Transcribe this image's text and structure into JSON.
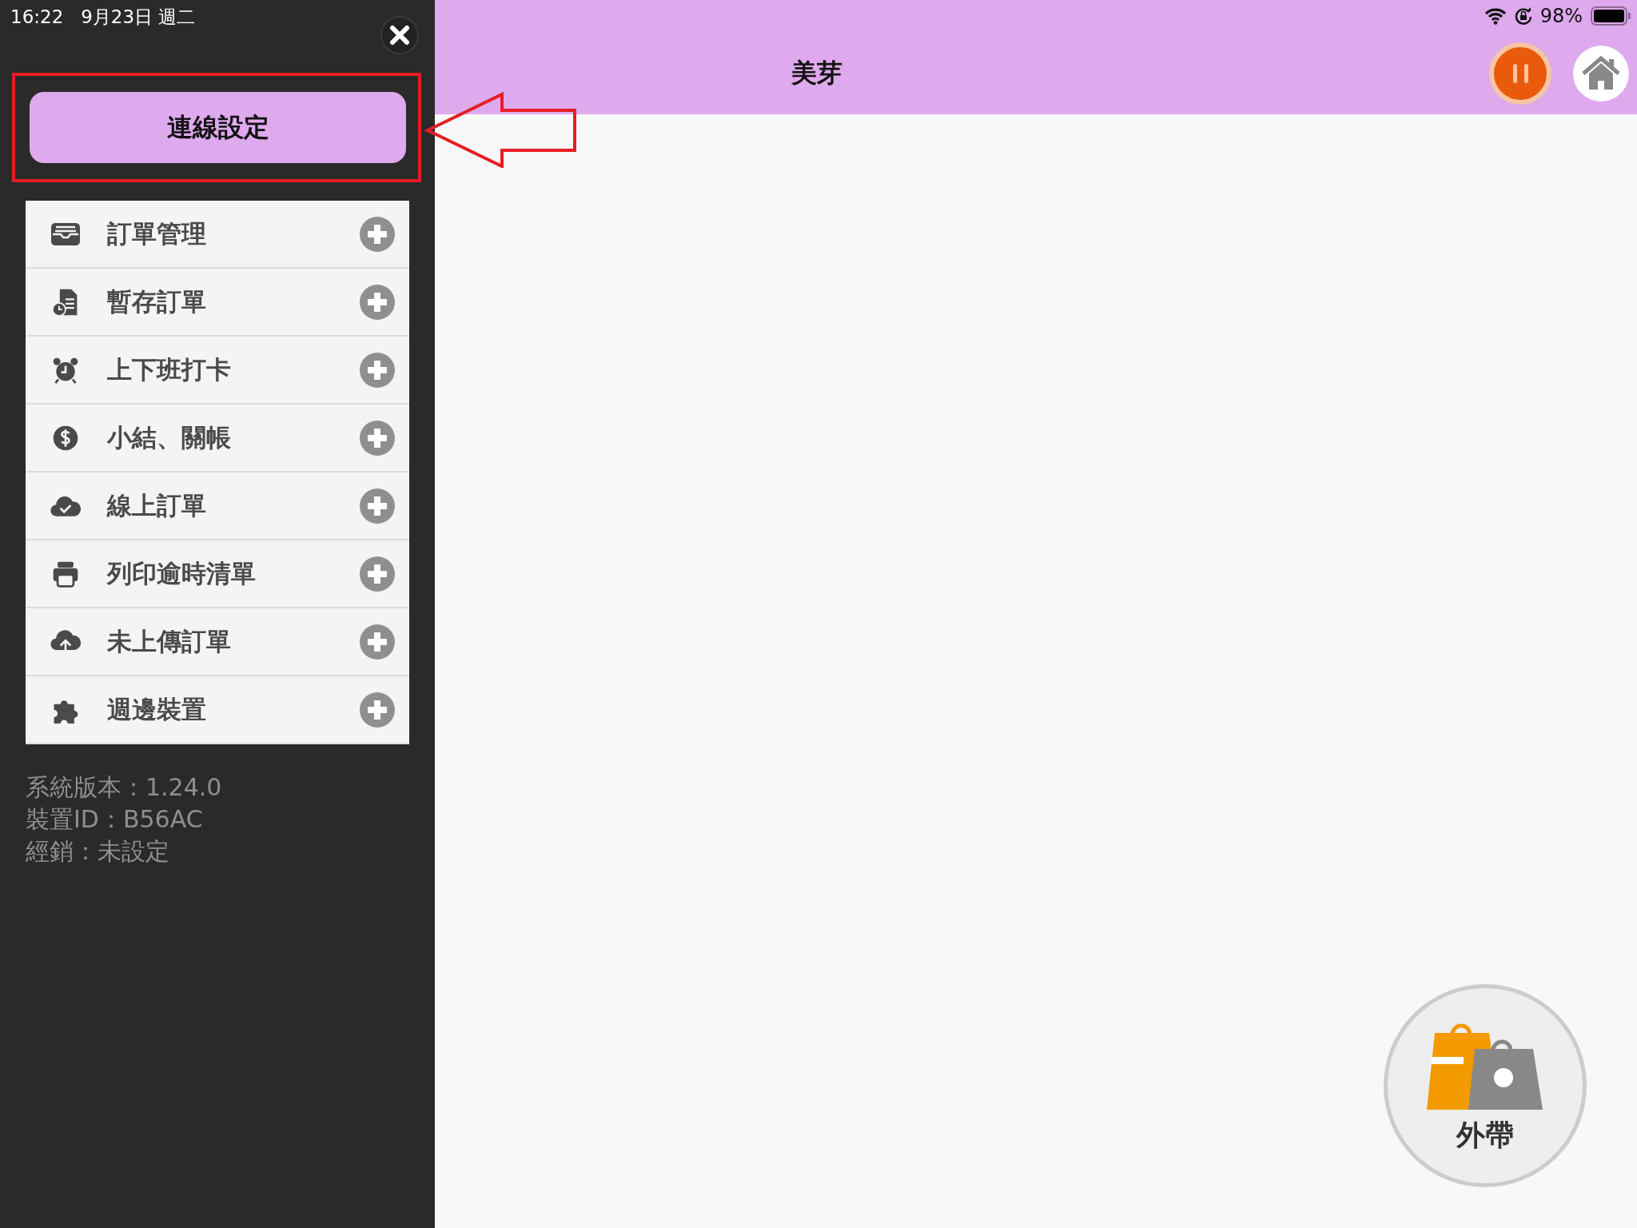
{
  "status_bar": {
    "time": "16:22",
    "date": "9月23日 週二",
    "battery": "98%"
  },
  "sidebar": {
    "connection_button": "連線設定",
    "menu": [
      {
        "kind": "tray",
        "label": "訂單管理"
      },
      {
        "kind": "document",
        "label": "暫存訂單"
      },
      {
        "kind": "alarm",
        "label": "上下班打卡"
      },
      {
        "kind": "coin",
        "label": "小結、關帳"
      },
      {
        "kind": "cloudcheck",
        "label": "線上訂單"
      },
      {
        "kind": "printer",
        "label": "列印逾時清單"
      },
      {
        "kind": "cloudupload",
        "label": "未上傳訂單"
      },
      {
        "kind": "puzzle",
        "label": "週邊裝置"
      }
    ],
    "info": [
      "系統版本：1.24.0",
      "裝置ID：B56AC",
      "經銷：未設定"
    ]
  },
  "header": {
    "title": "美芽"
  },
  "takeaway_button": {
    "label": "外帶"
  }
}
